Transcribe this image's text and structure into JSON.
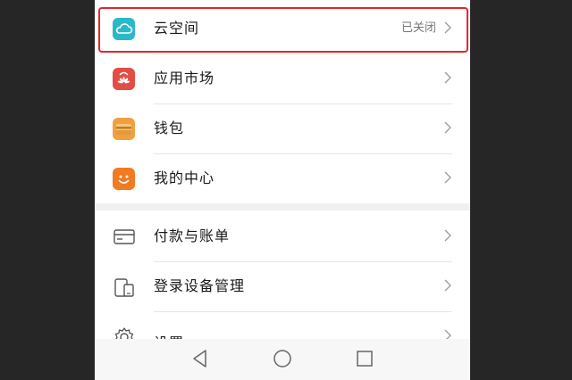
{
  "settings": {
    "items": [
      {
        "label": "云空间",
        "status": "已关闭",
        "icon": "cloud-icon",
        "color": "#2bb8c9"
      },
      {
        "label": "应用市场",
        "status": "",
        "icon": "huawei-appgallery-icon",
        "color": "#e24d44"
      },
      {
        "label": "钱包",
        "status": "",
        "icon": "wallet-icon",
        "color": "#f0a040"
      },
      {
        "label": "我的中心",
        "status": "",
        "icon": "smiley-icon",
        "color": "#f27a21"
      },
      {
        "label": "付款与账单",
        "status": "",
        "icon": "card-icon"
      },
      {
        "label": "登录设备管理",
        "status": "",
        "icon": "devices-icon"
      },
      {
        "label": "设置",
        "status": "",
        "icon": "gear-icon"
      }
    ]
  },
  "highlight_color": "#e3262a",
  "navbar": {
    "icons": [
      "back-icon",
      "home-icon",
      "recent-apps-icon"
    ]
  }
}
